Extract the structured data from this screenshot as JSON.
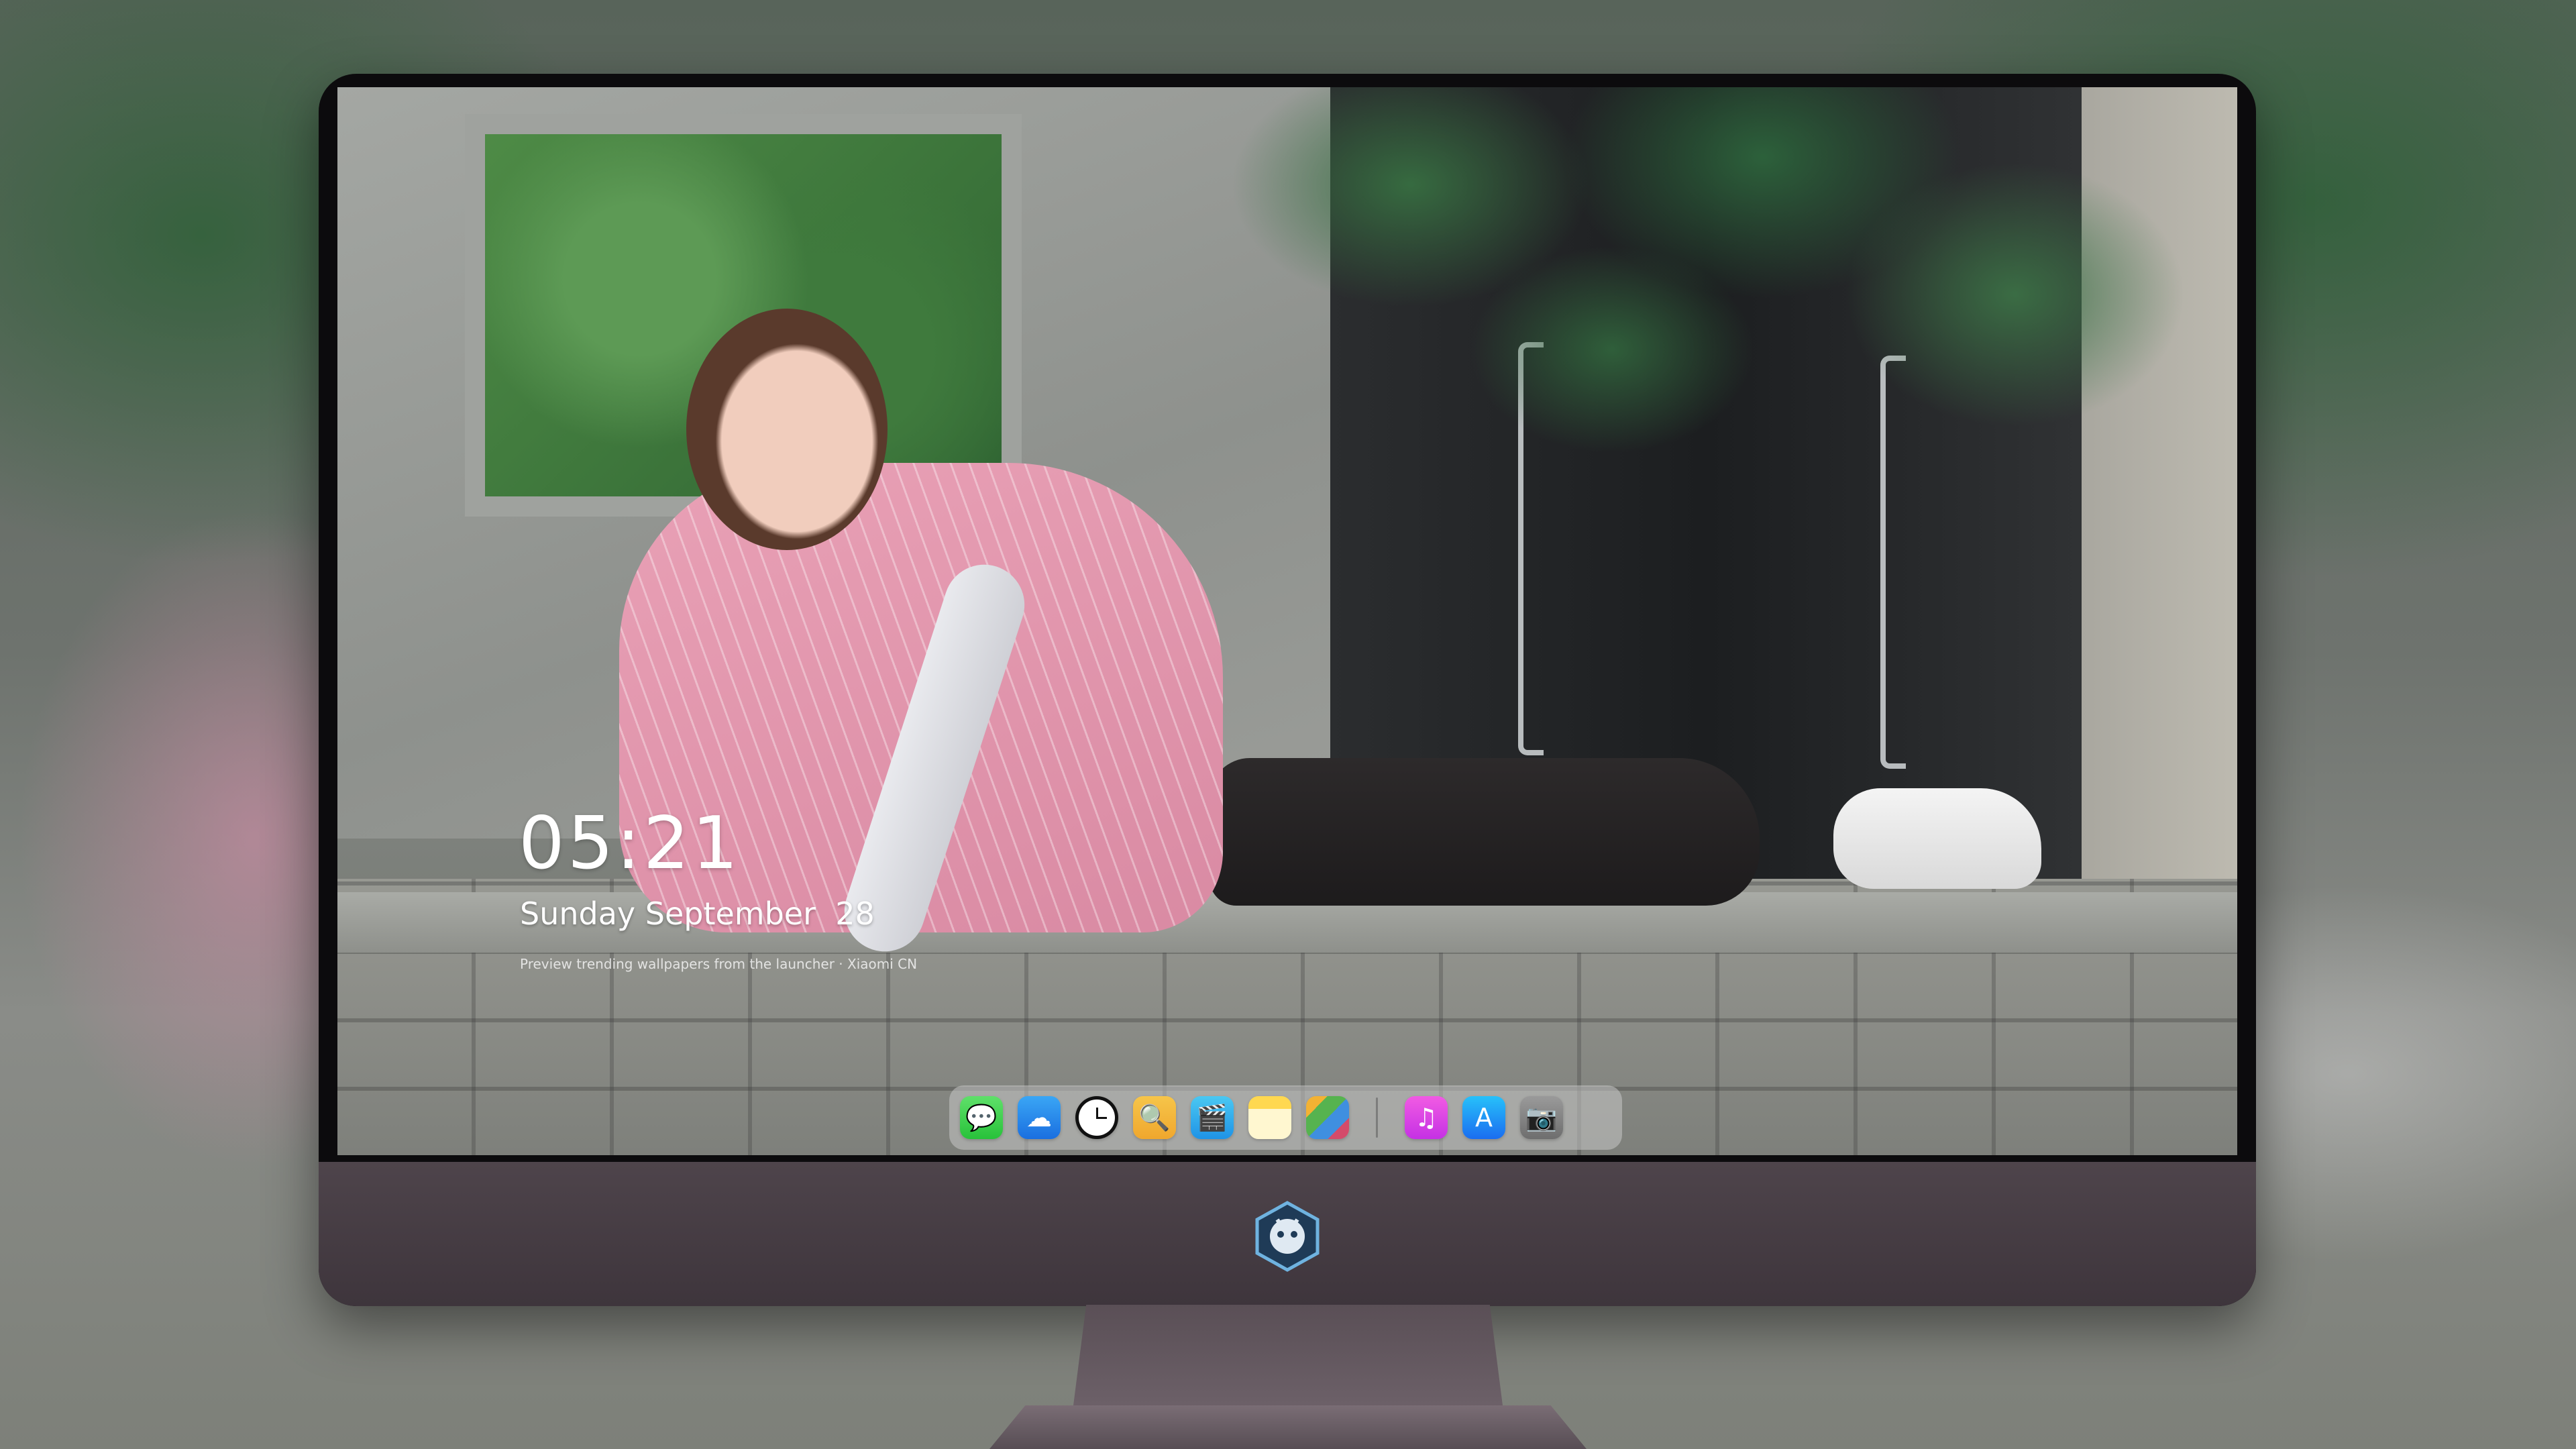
{
  "lock_screen": {
    "time": "05:21",
    "date": "Sunday September  28",
    "preview_note": "Preview trending wallpapers from the launcher · Xiaomi CN"
  },
  "dock": {
    "apps": [
      {
        "name": "messages-icon",
        "glyph": "💬"
      },
      {
        "name": "weather-icon",
        "glyph": "☁"
      },
      {
        "name": "clock-icon",
        "glyph": ""
      },
      {
        "name": "preview-icon",
        "glyph": "🔍"
      },
      {
        "name": "clips-icon",
        "glyph": "🎬"
      },
      {
        "name": "notes-icon",
        "glyph": ""
      },
      {
        "name": "photo-booth-icon",
        "glyph": ""
      },
      {
        "name": "music-icon",
        "glyph": "♫"
      },
      {
        "name": "app-store-icon",
        "glyph": "A"
      },
      {
        "name": "camera-icon",
        "glyph": "📷"
      }
    ]
  },
  "colors": {
    "monitor_chin": "#4e444b",
    "dock_background": "rgba(205,205,205,0.5)",
    "text": "#ffffff"
  },
  "wallpaper": {
    "subject": "photo-wallpaper"
  },
  "monitor": {
    "logo": "brand-logo-icon"
  }
}
